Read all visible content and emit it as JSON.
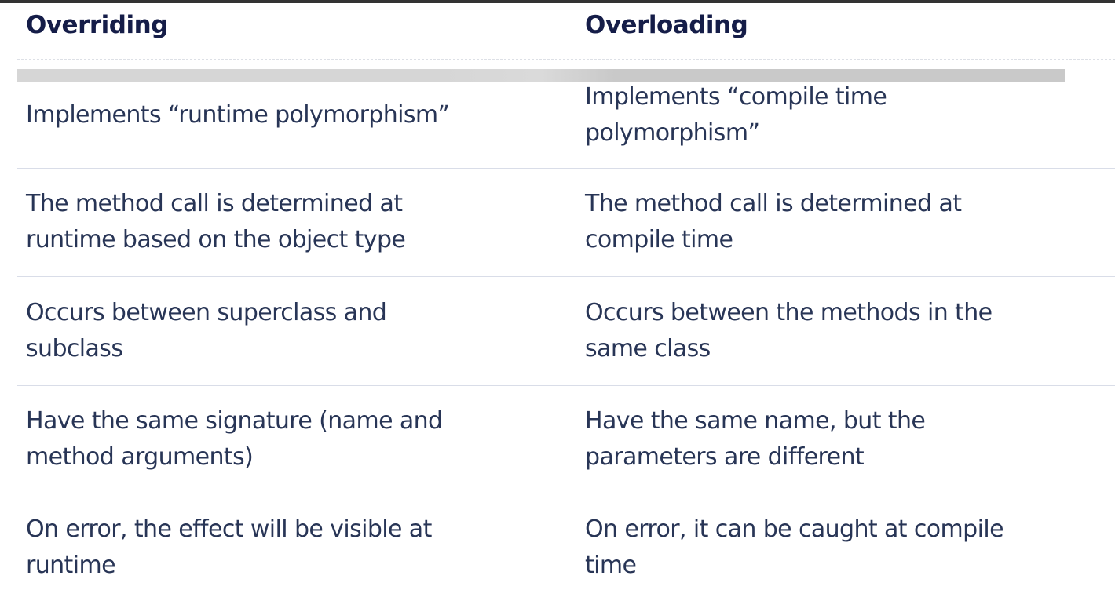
{
  "headers": [
    "Overriding",
    "Overloading"
  ],
  "rows": [
    {
      "overriding": [
        "Implements “runtime polymorphism”"
      ],
      "overloading": [
        "Implements “compile time",
        "polymorphism”"
      ]
    },
    {
      "overriding": [
        "The method call is determined at",
        "runtime based on the object type"
      ],
      "overloading": [
        "The method call is determined at",
        "compile time"
      ]
    },
    {
      "overriding": [
        "Occurs between superclass and",
        "subclass"
      ],
      "overloading": [
        "Occurs between the methods in the",
        "same class"
      ]
    },
    {
      "overriding": [
        "Have the same signature (name and",
        "method arguments)"
      ],
      "overloading": [
        "Have the same name, but the",
        "parameters are different"
      ]
    },
    {
      "overriding": [
        "On error, the effect will be visible at",
        "runtime"
      ],
      "overloading": [
        "On error, it can be caught at compile",
        "time"
      ]
    }
  ]
}
